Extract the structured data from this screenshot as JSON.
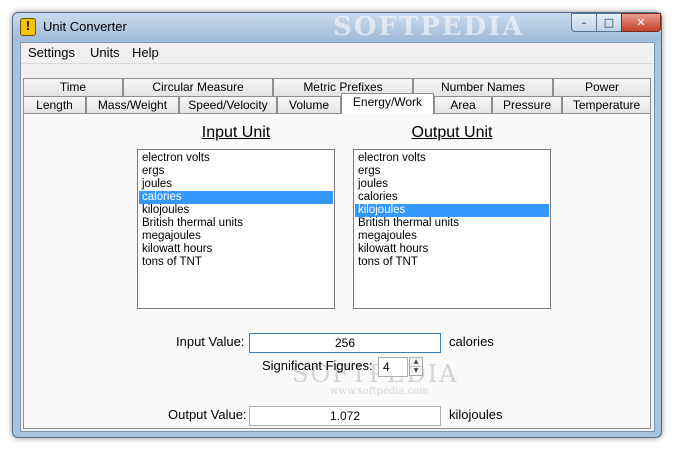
{
  "window": {
    "title": "Unit Converter",
    "watermark": "SOFTPEDIA"
  },
  "menu": [
    "Settings",
    "Units",
    "Help"
  ],
  "tabs": {
    "row1": [
      "Time",
      "Circular Measure",
      "Metric Prefixes",
      "Number Names",
      "Power"
    ],
    "row2": [
      "Length",
      "Mass/Weight",
      "Speed/Velocity",
      "Volume",
      "Energy/Work",
      "Area",
      "Pressure",
      "Temperature"
    ],
    "active": "Energy/Work"
  },
  "input_unit": {
    "heading": "Input Unit",
    "items": [
      "electron volts",
      "ergs",
      "joules",
      "calories",
      "kilojoules",
      "British thermal units",
      "megajoules",
      "kilowatt hours",
      "tons of TNT"
    ],
    "selected": "calories"
  },
  "output_unit": {
    "heading": "Output Unit",
    "items": [
      "electron volts",
      "ergs",
      "joules",
      "calories",
      "kilojoules",
      "British thermal units",
      "megajoules",
      "kilowatt hours",
      "tons of TNT"
    ],
    "selected": "kilojoules"
  },
  "form": {
    "input_label": "Input Value:",
    "input_value": "256",
    "input_unit": "calories",
    "sig_label": "Significant Figures:",
    "sig_value": "4",
    "output_label": "Output Value:",
    "output_value": "1.072",
    "output_unit": "kilojoules"
  },
  "watermark_text": {
    "big": "SOFTPEDIA",
    "url": "www.softpedia.com"
  }
}
